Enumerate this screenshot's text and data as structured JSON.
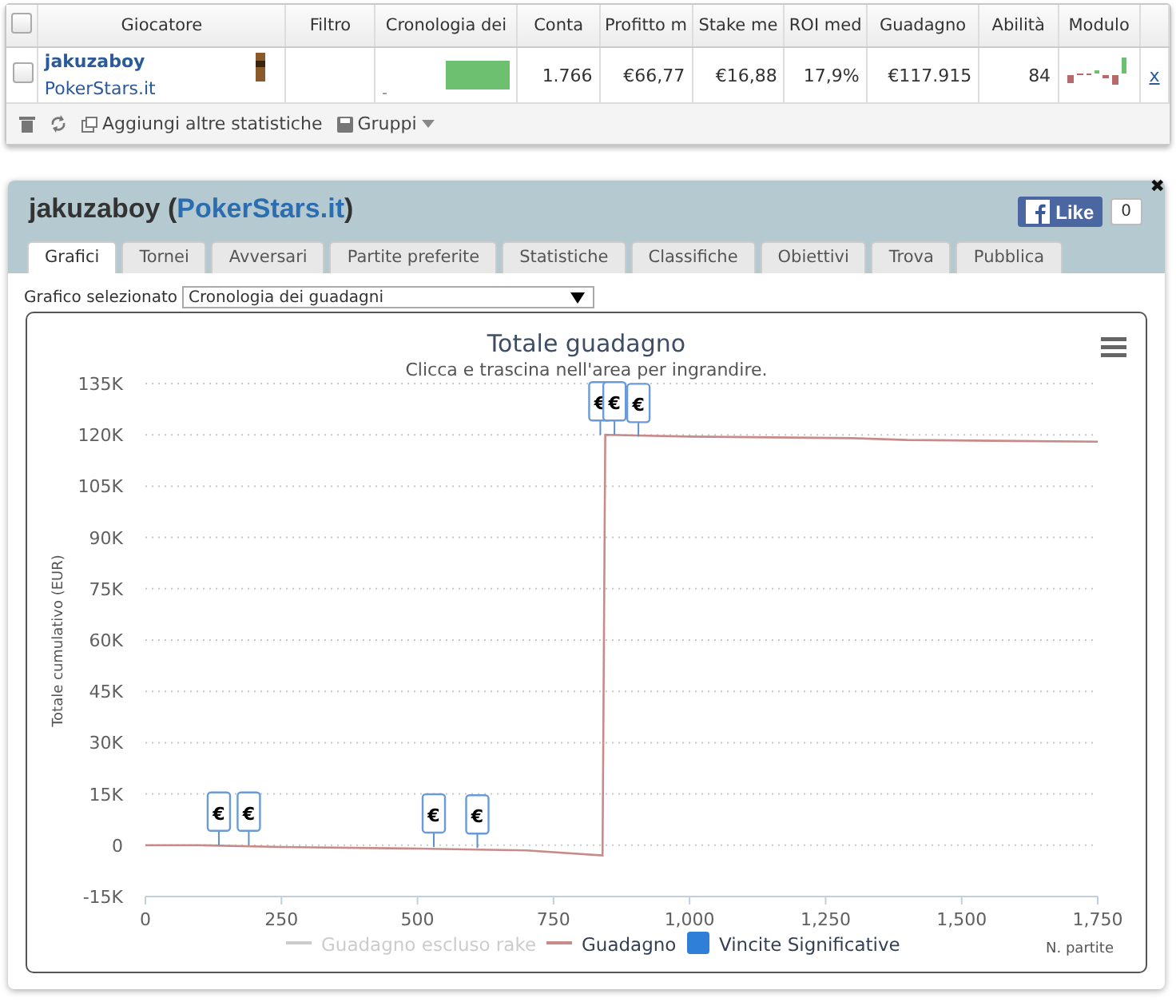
{
  "players_table": {
    "all_selected": false,
    "columns": [
      "Giocatore",
      "Filtro",
      "Cronologia dei",
      "Conta",
      "Profitto m",
      "Stake me",
      "ROI med",
      "Guadagno",
      "Abilità",
      "Modulo"
    ],
    "rows": [
      {
        "selected": false,
        "name": "jakuzaboy",
        "site": "PokerStars.it",
        "history_mark": "-",
        "count": "1.766",
        "avg_profit": "€66,77",
        "avg_stake": "€16,88",
        "avg_roi": "17,9%",
        "profit": "€117.915",
        "ability": "84",
        "remove": "x"
      }
    ],
    "toolbar": [
      {
        "kind": "delete"
      },
      {
        "kind": "refresh"
      },
      {
        "kind": "add",
        "label": "Aggiungi altre statistiche"
      },
      {
        "kind": "groups",
        "label": "Gruppi"
      }
    ]
  },
  "player_panel": {
    "name": "jakuzaboy",
    "site_open": "(",
    "site": "PokerStars.it",
    "site_close": ")",
    "like": {
      "label": "Like",
      "count": "0"
    },
    "close": "✖",
    "tabs": [
      {
        "label": "Grafici",
        "selected": true
      },
      {
        "label": "Tornei",
        "selected": false
      },
      {
        "label": "Avversari",
        "selected": false
      },
      {
        "label": "Partite preferite",
        "selected": false
      },
      {
        "label": "Statistiche",
        "selected": false
      },
      {
        "label": "Classifiche",
        "selected": false
      },
      {
        "label": "Obiettivi",
        "selected": false
      },
      {
        "label": "Trova",
        "selected": false
      },
      {
        "label": "Pubblica",
        "selected": false
      }
    ],
    "chart_select": {
      "label": "Grafico selezionato",
      "value": "Cronologia dei guadagni"
    },
    "chart": {
      "subtitle": "Clicca e trascina nell'area per ingrandire.",
      "chart_data": {
        "type": "line",
        "title": "Totale guadagno",
        "xlabel": "N. partite",
        "ylabel": "Totale cumulativo (EUR)",
        "xlim": [
          0,
          1750
        ],
        "grid": true,
        "ylim": [
          -15000,
          135000
        ],
        "xticks": [
          {
            "value": 0,
            "label": "0"
          },
          {
            "value": 250,
            "label": "250"
          },
          {
            "value": 500,
            "label": "500"
          },
          {
            "value": 750,
            "label": "750"
          },
          {
            "value": 1000,
            "label": "1,000"
          },
          {
            "value": 1250,
            "label": "1,250"
          },
          {
            "value": 1500,
            "label": "1,500"
          },
          {
            "value": 1750,
            "label": "1,750"
          }
        ],
        "yticks": [
          {
            "value": -15000,
            "label": "-15K"
          },
          {
            "value": 0,
            "label": "0"
          },
          {
            "value": 15000,
            "label": "15K"
          },
          {
            "value": 30000,
            "label": "30K"
          },
          {
            "value": 45000,
            "label": "45K"
          },
          {
            "value": 60000,
            "label": "60K"
          },
          {
            "value": 75000,
            "label": "75K"
          },
          {
            "value": 90000,
            "label": "90K"
          },
          {
            "value": 105000,
            "label": "105K"
          },
          {
            "value": 120000,
            "label": "120K"
          },
          {
            "value": 135000,
            "label": "135K"
          }
        ],
        "x": [
          0,
          100,
          250,
          500,
          700,
          840,
          845,
          1000,
          1300,
          1400,
          1750
        ],
        "series": [
          {
            "name": "Guadagno",
            "color": "#c98a8a",
            "values": [
              0,
              0,
              -500,
              -1000,
              -1500,
              -3000,
              120000,
              119500,
              119000,
              118500,
              118000
            ]
          }
        ]
      },
      "flags": [
        {
          "label": "€"
        },
        {
          "label": "€"
        },
        {
          "label": "€"
        },
        {
          "label": "€"
        },
        {
          "label": "€"
        },
        {
          "label": "€"
        },
        {
          "label": "€"
        }
      ],
      "legend": [
        {
          "kind": "line",
          "label": "Guadagno escluso rake",
          "visible": false
        },
        {
          "kind": "series",
          "visible": true
        },
        {
          "kind": "flag",
          "label": "Vincite Significative",
          "visible": true,
          "color": "#2f7ed8"
        }
      ]
    }
  }
}
